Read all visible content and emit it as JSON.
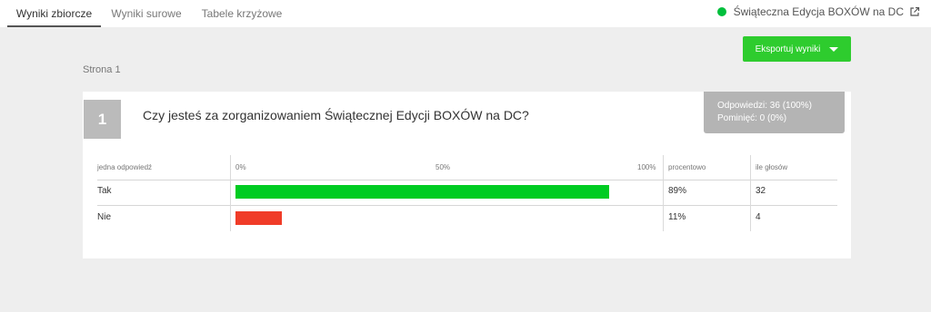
{
  "tabs": [
    {
      "label": "Wyniki zbiorcze",
      "active": true
    },
    {
      "label": "Wyniki surowe",
      "active": false
    },
    {
      "label": "Tabele krzyżowe",
      "active": false
    }
  ],
  "survey": {
    "title": "Świąteczna Edycja BOXÓW na DC",
    "status_color": "#00bf3c"
  },
  "export_button": {
    "label": "Eksportuj wyniki"
  },
  "page_label": "Strona 1",
  "question": {
    "number": "1",
    "text": "Czy jesteś za zorganizowaniem Świątecznej Edycji BOXÓW na DC?",
    "answered": "Odpowiedzi: 36 (100%)",
    "skipped": "Pominięć: 0 (0%)"
  },
  "table": {
    "headers": {
      "answer": "jedna odpowiedź",
      "scale_min": "0%",
      "scale_mid": "50%",
      "scale_max": "100%",
      "percent": "procentowo",
      "votes": "ile głosów"
    },
    "rows": [
      {
        "label": "Tak",
        "percent_label": "89%",
        "votes": "32",
        "share": 0.89,
        "color": "#00cc22"
      },
      {
        "label": "Nie",
        "percent_label": "11%",
        "votes": "4",
        "share": 0.11,
        "color": "#f03c28"
      }
    ]
  },
  "colors": {
    "accent_green": "#2ecc2e",
    "stats_bg": "#b4b4b4"
  }
}
